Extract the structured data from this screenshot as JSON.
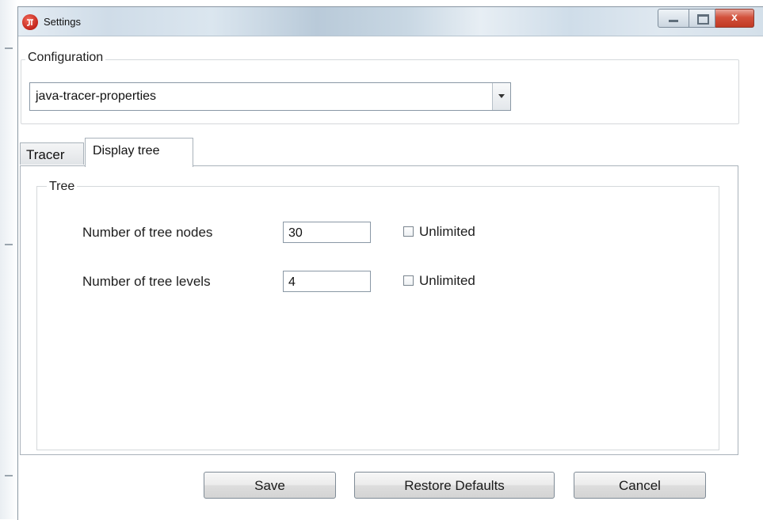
{
  "window": {
    "title": "Settings",
    "close_glyph": "x",
    "icon": "app-logo-icon"
  },
  "configuration": {
    "legend": "Configuration",
    "selected": "java-tracer-properties"
  },
  "tabs": [
    {
      "label": "Tracer",
      "active": false
    },
    {
      "label": "Display tree",
      "active": true
    }
  ],
  "tree": {
    "legend": "Tree",
    "nodes": {
      "label": "Number of tree nodes",
      "value": "30",
      "unlimited_label": "Unlimited",
      "unlimited_checked": false
    },
    "levels": {
      "label": "Number of tree levels",
      "value": "4",
      "unlimited_label": "Unlimited",
      "unlimited_checked": false
    }
  },
  "buttons": {
    "save": "Save",
    "restore": "Restore Defaults",
    "cancel": "Cancel"
  }
}
